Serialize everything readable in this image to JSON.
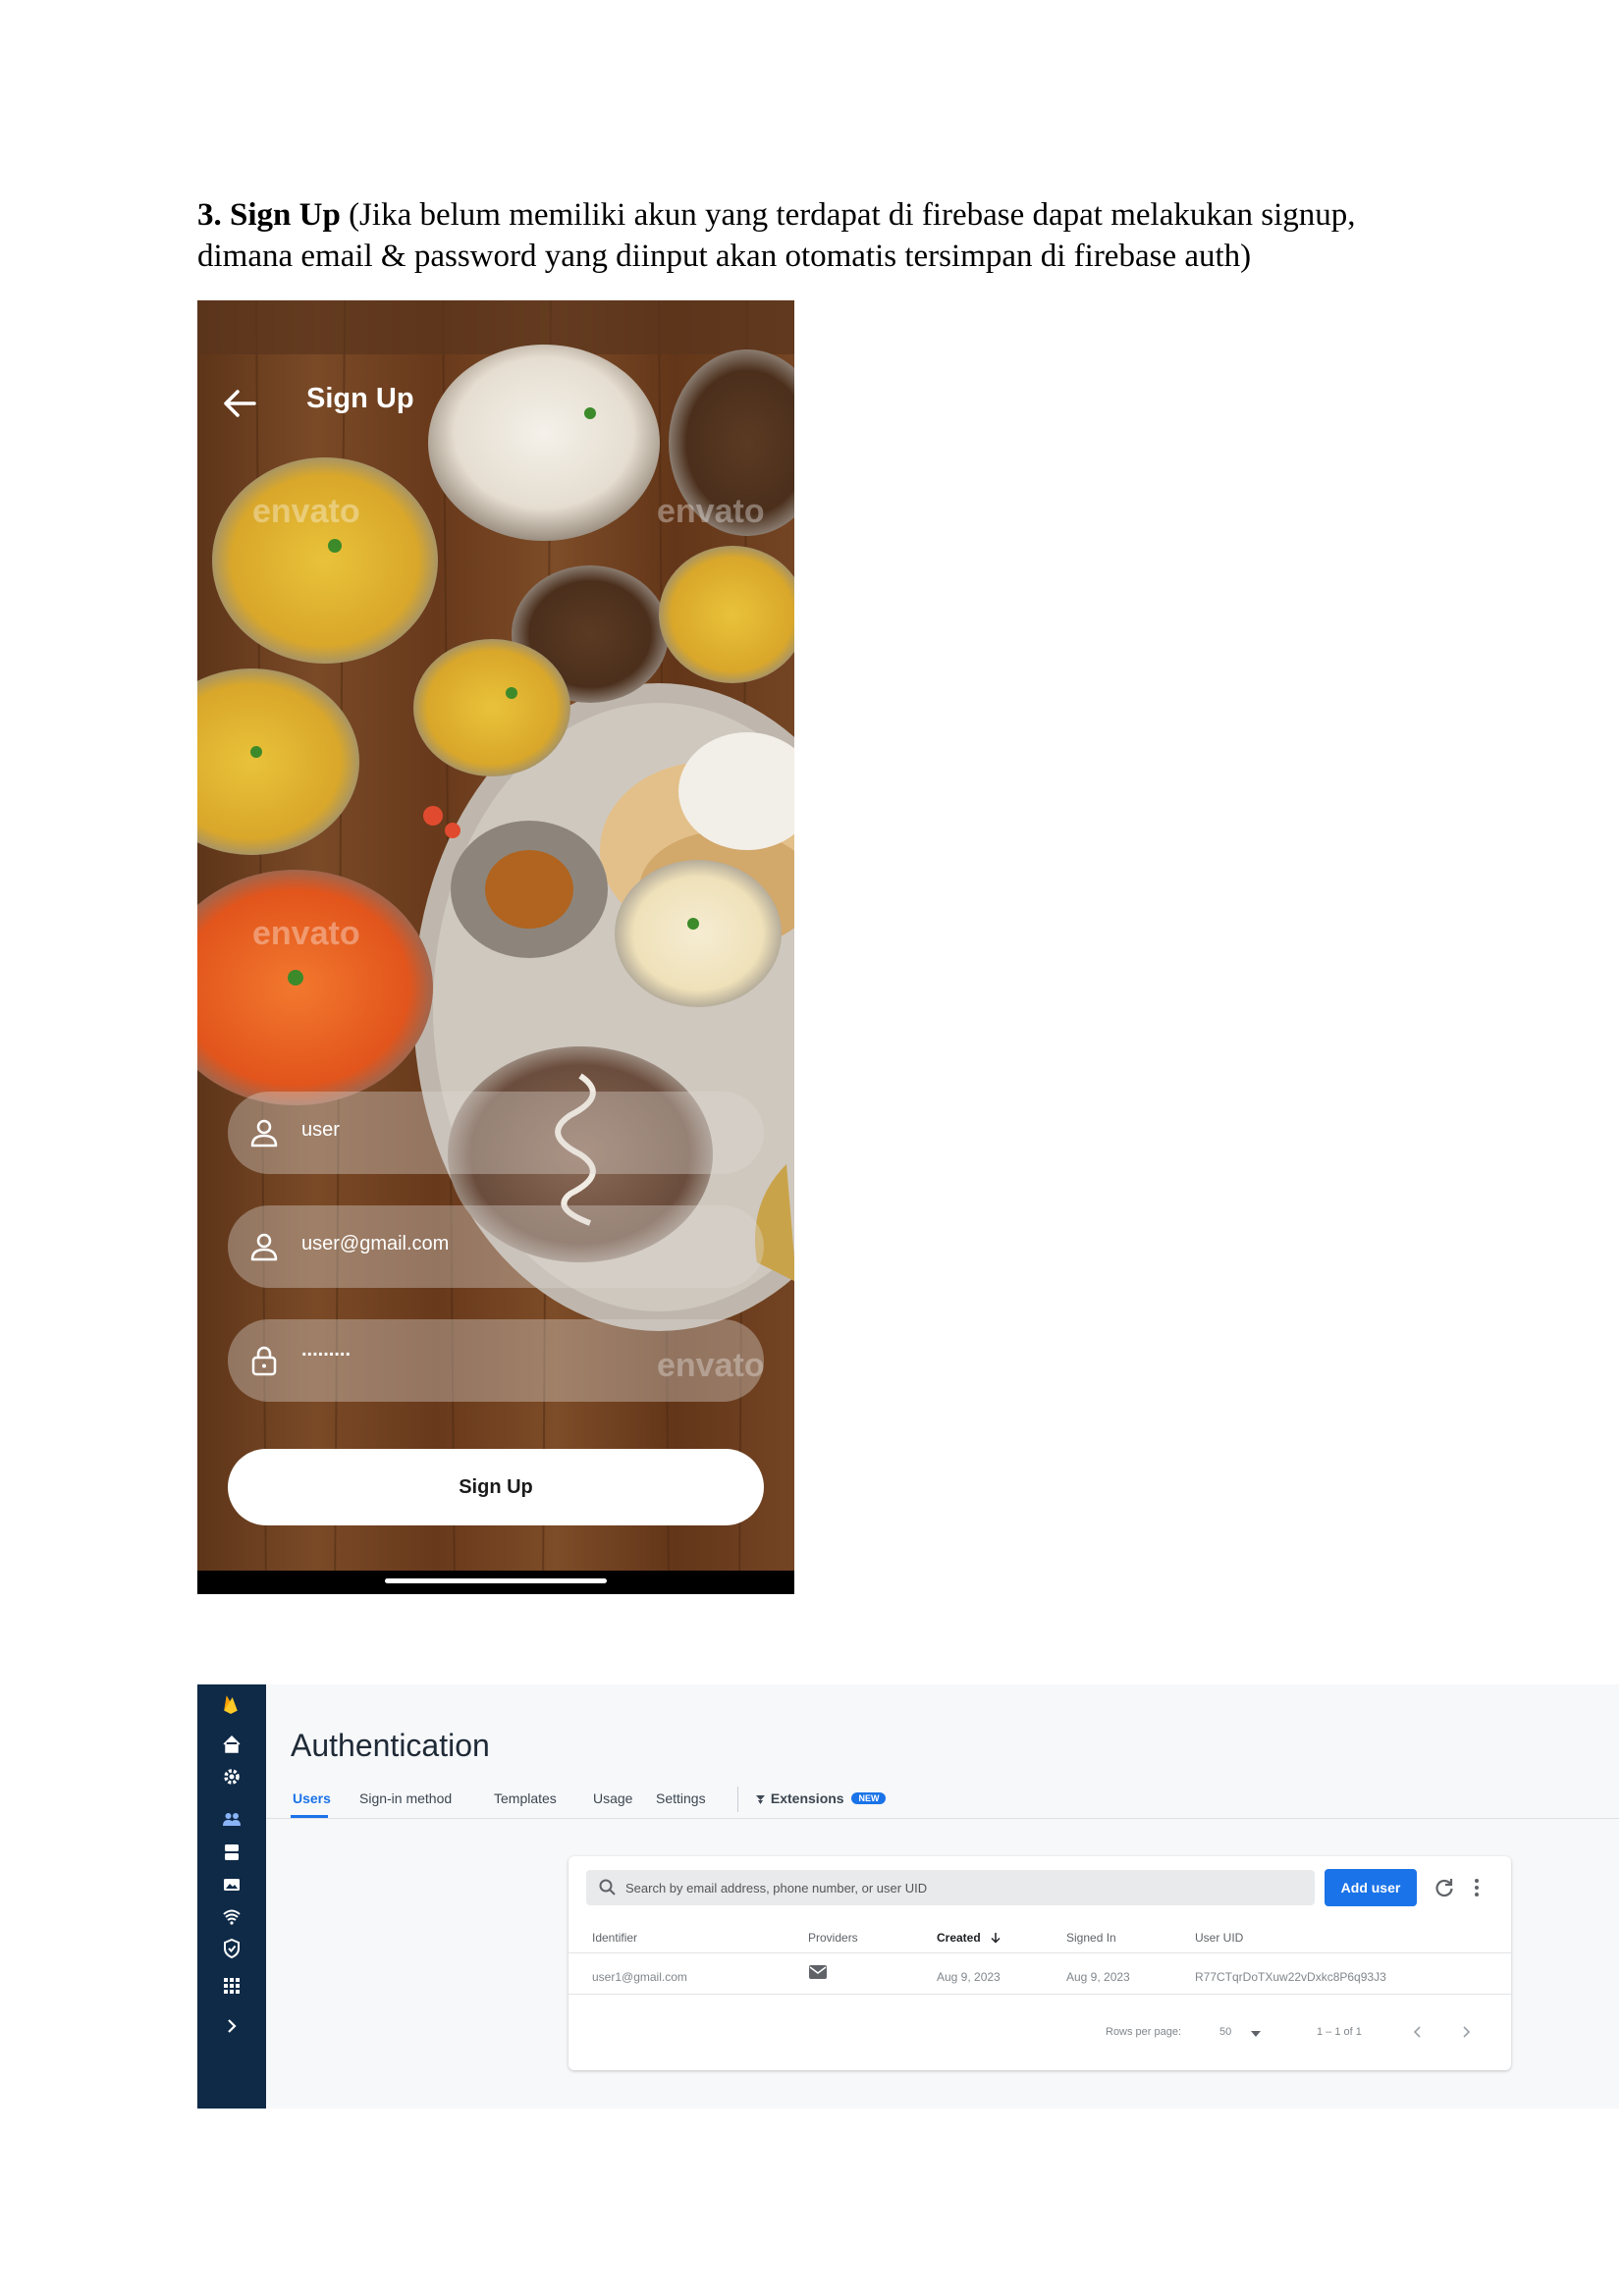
{
  "document": {
    "heading_bold": "3. Sign Up",
    "heading_rest": " (Jika belum memiliki akun yang terdapat di firebase dapat melakukan signup, dimana email & password yang diinput akan otomatis tersimpan di firebase auth)"
  },
  "phone": {
    "title": "Sign Up",
    "fields": {
      "username": "user",
      "email": "user@gmail.com",
      "password": "........."
    },
    "signup_button": "Sign Up",
    "watermark": "envato"
  },
  "console": {
    "title": "Authentication",
    "tabs": [
      "Users",
      "Sign-in method",
      "Templates",
      "Usage",
      "Settings",
      "Extensions"
    ],
    "new_badge": "NEW",
    "search_placeholder": "Search by email address, phone number, or user UID",
    "add_user_label": "Add user",
    "table": {
      "headers": [
        "Identifier",
        "Providers",
        "Created",
        "Signed In",
        "User UID"
      ],
      "rows": [
        [
          "user1@gmail.com",
          "email",
          "Aug 9, 2023",
          "Aug 9, 2023",
          "R77CTqrDoTXuw22vDxkc8P6q93J3"
        ]
      ]
    },
    "footer": {
      "rows_per_page_label": "Rows per page:",
      "rows_per_page_value": "50",
      "range": "1 – 1 of 1"
    }
  },
  "colors": {
    "accent": "#1a73e8",
    "rail": "#0e2a47",
    "firebase_flame": "#ffca28"
  }
}
